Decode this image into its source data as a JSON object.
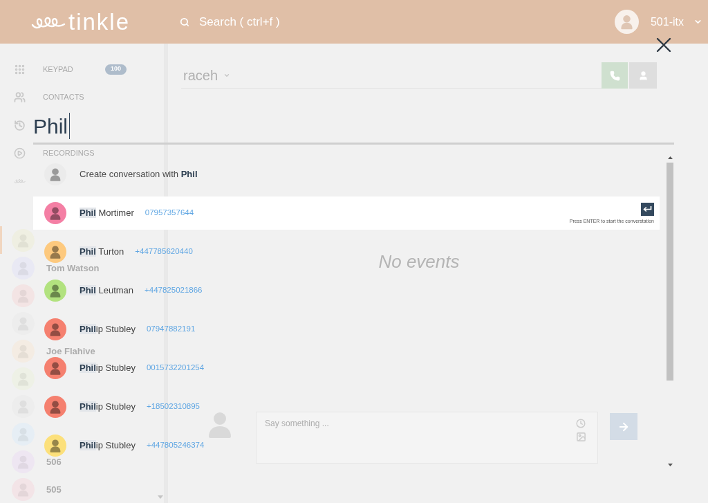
{
  "header": {
    "logo": "tinkle",
    "search": {
      "placeholder": "Search ( ctrl+f )"
    },
    "user": "501-itx"
  },
  "sidebar": {
    "items": [
      {
        "kind": "keypad",
        "label": "KEYPAD",
        "badge": "100"
      },
      {
        "kind": "contacts",
        "label": "CONTACTS"
      },
      {
        "kind": "history"
      },
      {
        "kind": "recordings",
        "label": "RECORDINGS"
      },
      {
        "kind": "manager"
      }
    ],
    "recents": [
      {
        "color": "#efefe2",
        "selected": true
      },
      {
        "color": "#e9e9f4",
        "name": "Tom Watson",
        "selected": false
      },
      {
        "color": "#f3e4e4",
        "selected": false
      },
      {
        "color": "#ededed",
        "selected": false
      },
      {
        "color": "#f4ece3",
        "name": "Joe Flahive",
        "selected": false
      },
      {
        "color": "#eef1e6",
        "selected": false
      },
      {
        "color": "#ededed",
        "selected": false
      },
      {
        "color": "#e6eef5",
        "selected": false
      },
      {
        "color": "#eee6f2",
        "name": "506",
        "selected": false
      },
      {
        "color": "#f3e4e7",
        "name": "505",
        "selected": false
      }
    ]
  },
  "conversation": {
    "contact": "raceh",
    "empty_message": "No events",
    "composer": {
      "placeholder": "Say something ..."
    }
  },
  "search_overlay": {
    "query": "Phil",
    "create_option": "Create conversation with **Phil**",
    "enter_hint": "Press ENTER to start the converstation",
    "results": [
      {
        "name": "**Phil** Mortimer",
        "phone": "07957357644",
        "color": "#f47fa4",
        "selected": true
      },
      {
        "name": "**Phil** Turton",
        "phone": "+447785620440",
        "color": "#fdc97e",
        "selected": false
      },
      {
        "name": "**Phil** Leutman",
        "phone": "+447825021866",
        "color": "#b2e27f",
        "selected": false
      },
      {
        "name": "**Phil**ip Stubley",
        "phone": "07947882191",
        "color": "#f5806f",
        "selected": false
      },
      {
        "name": "**Phil**ip Stubley",
        "phone": "0015732201254",
        "color": "#f5806f",
        "selected": false
      },
      {
        "name": "**Phil**ip Stubley",
        "phone": "+18502310895",
        "color": "#f5806f",
        "selected": false
      },
      {
        "name": "**Phil**ip Stubley",
        "phone": "+447805246374",
        "color": "#fce07b",
        "selected": false
      }
    ]
  }
}
